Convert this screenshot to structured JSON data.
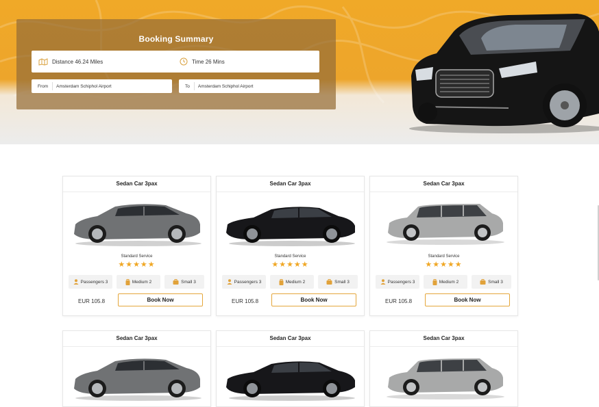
{
  "summary": {
    "title": "Booking Summary",
    "distance": "Distance 46.24 Miles",
    "time": "Time  26 Mins",
    "from_label": "From",
    "from_value": "Amsterdam Schiphol Airport",
    "to_label": "To",
    "to_value": "Amsterdam Schiphol Airport"
  },
  "colors": {
    "accent": "#f0a724",
    "button_border": "#e4a63a"
  },
  "cards": [
    {
      "title": "Sedan Car 3pax",
      "service": "Standard Service",
      "stars": "★★★★★",
      "passengers": "Passengers 3",
      "medium": "Medium 2",
      "small": "Small 3",
      "price": "EUR 105.8",
      "button": "Book Now",
      "car_icon": "grey-sedan"
    },
    {
      "title": "Sedan Car 3pax",
      "service": "Standard Service",
      "stars": "★★★★★",
      "passengers": "Passengers 3",
      "medium": "Medium 2",
      "small": "Small 3",
      "price": "EUR 105.8",
      "button": "Book Now",
      "car_icon": "black-sedan"
    },
    {
      "title": "Sedan Car 3pax",
      "service": "Standard Service",
      "stars": "★★★★★",
      "passengers": "Passengers 3",
      "medium": "Medium 2",
      "small": "Small 3",
      "price": "EUR 105.8",
      "button": "Book Now",
      "car_icon": "silver-wagon"
    },
    {
      "title": "Sedan Car 3pax",
      "car_icon": "grey-sedan"
    },
    {
      "title": "Sedan Car 3pax",
      "car_icon": "black-sedan"
    },
    {
      "title": "Sedan Car 3pax",
      "car_icon": "silver-wagon"
    }
  ]
}
